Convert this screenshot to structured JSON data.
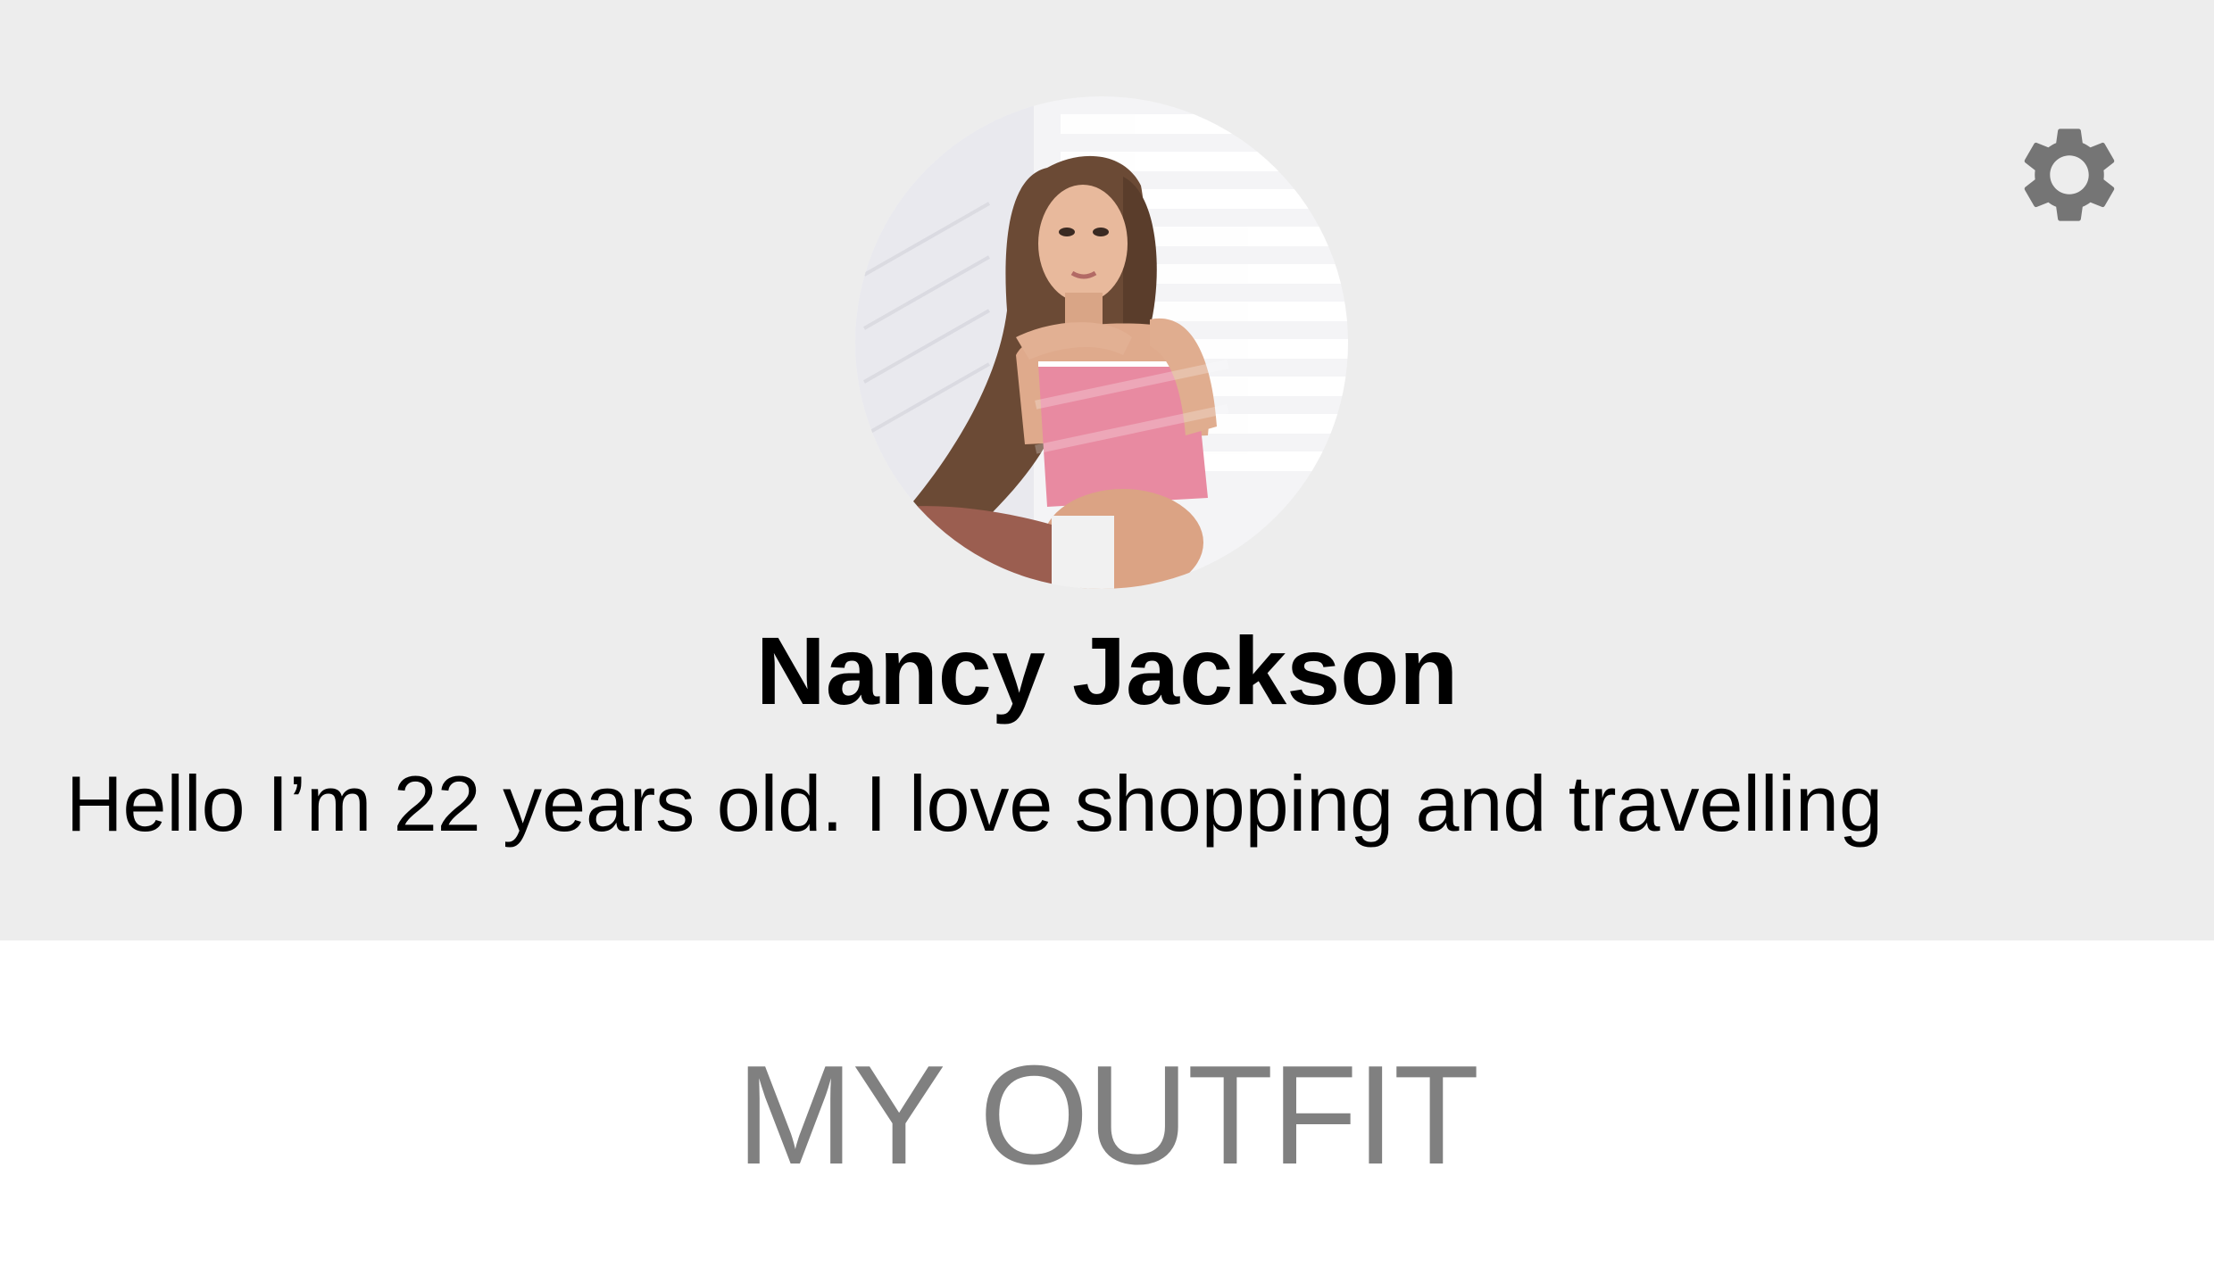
{
  "profile": {
    "name": "Nancy Jackson",
    "bio": "Hello I’m 22 years old.  I love shopping and travelling",
    "avatar_icon": "profile-photo",
    "header_background": "#ededed"
  },
  "toolbar": {
    "settings_icon": "gear-icon",
    "icon_color": "#757575"
  },
  "outfit": {
    "section_title": "MY OUTFIT",
    "title_color": "#808080"
  }
}
